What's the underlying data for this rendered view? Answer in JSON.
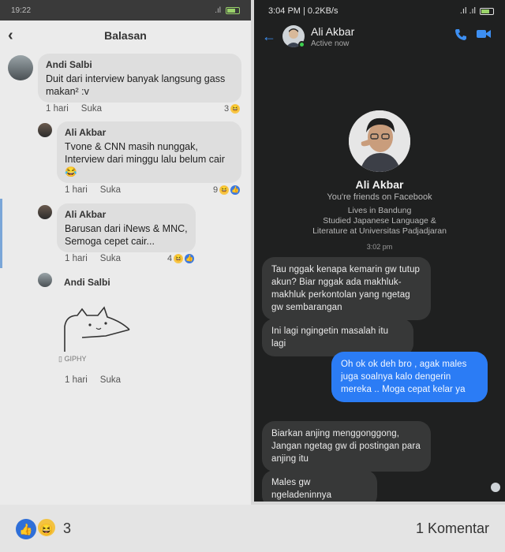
{
  "left": {
    "status_time": "19:22",
    "header_title": "Balasan",
    "comments": [
      {
        "name": "Andi Salbi",
        "text": "Duit dari interview banyak langsung gass makan² :v",
        "time": "1 hari",
        "like": "Suka",
        "reactions": "3"
      },
      {
        "name": "Ali Akbar",
        "text": "Tvone & CNN masih nunggak, Interview dari minggu lalu belum cair 😂",
        "time": "1 hari",
        "like": "Suka",
        "reactions": "9"
      },
      {
        "name": "Ali Akbar",
        "text": "Barusan dari iNews & MNC, Semoga cepet cair...",
        "time": "1 hari",
        "like": "Suka",
        "reactions": "4"
      },
      {
        "name": "Andi Salbi",
        "text": "",
        "time": "1 hari",
        "like": "Suka",
        "reactions": ""
      }
    ],
    "giphy_label": "GIPHY"
  },
  "right": {
    "status_left": "3:04 PM | 0.2KB/s",
    "contact_name": "Ali Akbar",
    "contact_status": "Active now",
    "profile": {
      "name": "Ali Akbar",
      "friends": "You're friends on Facebook",
      "lives": "Lives in Bandung",
      "studied1": "Studied Japanese Language &",
      "studied2": "Literature at Universitas Padjadjaran"
    },
    "timestamp": "3:02 pm",
    "messages": [
      {
        "dir": "in",
        "text": "Tau nggak kenapa kemarin gw tutup akun? Biar nggak ada makhluk-makhluk perkontolan yang ngetag gw sembarangan"
      },
      {
        "dir": "in",
        "text": "Ini lagi ngingetin masalah itu lagi"
      },
      {
        "dir": "out",
        "text": "Oh ok ok deh bro , agak males juga soalnya kalo dengerin mereka .. Moga cepat kelar ya"
      },
      {
        "dir": "in",
        "text": "Biarkan anjing menggonggong, Jangan ngetag gw di postingan para anjing itu"
      },
      {
        "dir": "in",
        "text": "Males gw ngeladeninnya"
      }
    ]
  },
  "bottom": {
    "reaction_count": "3",
    "comments_label": "1 Komentar"
  },
  "colors": {
    "messenger_blue": "#2b7cf5",
    "facebook_like": "#3b79e0",
    "online_green": "#3ccf4e"
  },
  "icons": [
    "back-arrow-icon",
    "phone-icon",
    "video-icon",
    "like-icon",
    "haha-icon",
    "battery-icon"
  ]
}
